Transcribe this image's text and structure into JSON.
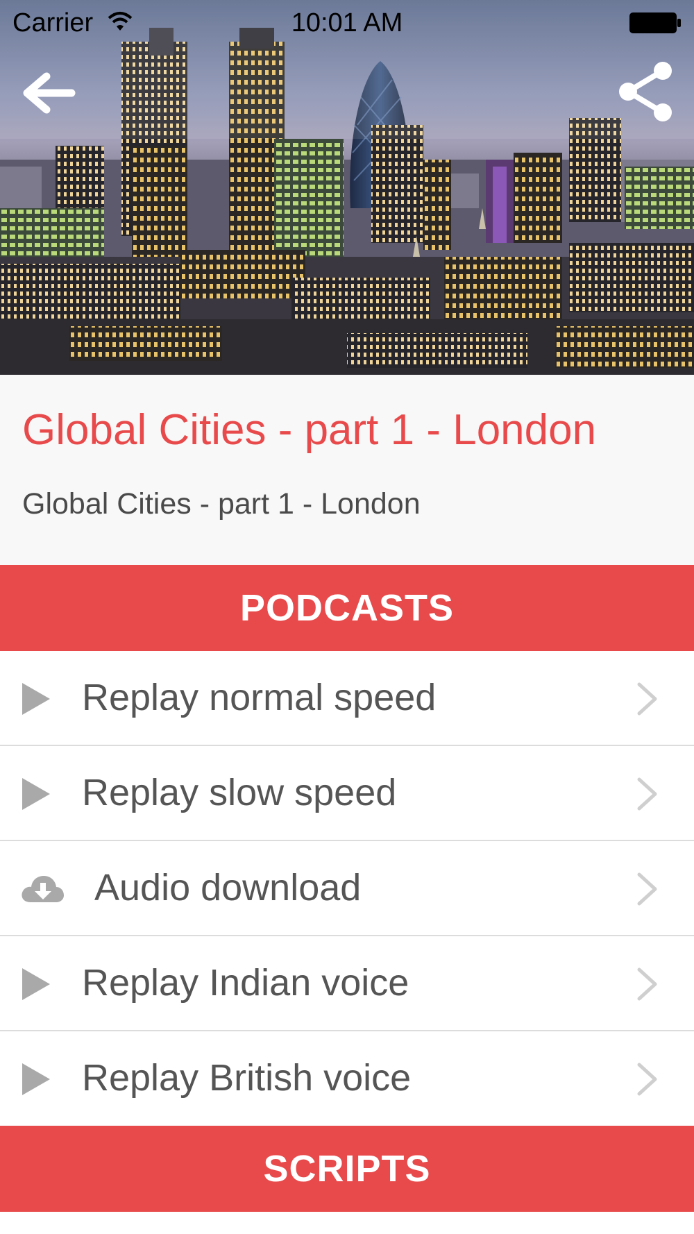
{
  "status_bar": {
    "carrier": "Carrier",
    "time": "10:01 AM"
  },
  "nav": {
    "back_icon": "back-arrow-icon",
    "share_icon": "share-icon"
  },
  "hero": {
    "image": "london-skyline-photo"
  },
  "header": {
    "title": "Global Cities - part 1 - London",
    "subtitle": "Global Cities - part 1 - London"
  },
  "sections": {
    "podcasts": "PODCASTS",
    "scripts": "SCRIPTS"
  },
  "podcast_items": [
    {
      "label": "Replay normal speed",
      "icon": "play-icon"
    },
    {
      "label": "Replay slow speed",
      "icon": "play-icon"
    },
    {
      "label": "Audio download",
      "icon": "cloud-download-icon"
    },
    {
      "label": "Replay Indian voice",
      "icon": "play-icon"
    },
    {
      "label": "Replay British voice",
      "icon": "play-icon"
    }
  ],
  "colors": {
    "accent": "#e84a4b",
    "title_bg": "#f8f8f8",
    "item_text": "#555555",
    "icon_gray": "#a9a9a9"
  }
}
